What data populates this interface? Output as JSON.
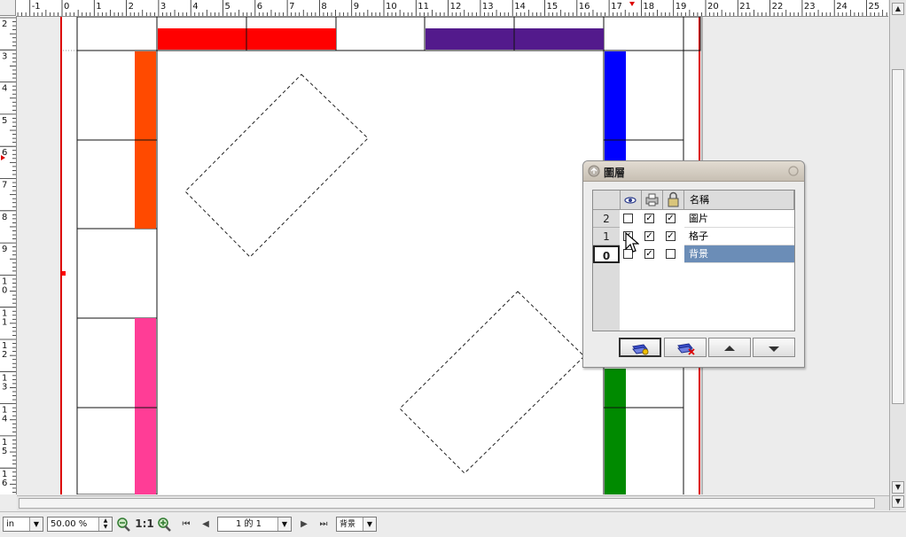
{
  "rulers": {
    "unit": "in",
    "horizontal_ticks": [
      "-1",
      "0",
      "1",
      "2",
      "3",
      "4",
      "5",
      "6",
      "7",
      "8",
      "9",
      "10",
      "11",
      "12",
      "13",
      "14",
      "15",
      "16",
      "17",
      "18",
      "19",
      "20",
      "21",
      "22",
      "23",
      "24",
      "25"
    ],
    "vertical_ticks": [
      "2",
      "3",
      "4",
      "5",
      "6",
      "7",
      "8",
      "9",
      "10",
      "11",
      "12",
      "13",
      "14",
      "15",
      "16"
    ]
  },
  "canvas": {
    "background": "#ececec",
    "page_color": "#ffffff",
    "margin_line_color": "#dd0000",
    "bars": {
      "top_red": "#ff0000",
      "top_purple": "#531a8c",
      "left_orange": "#ff4a00",
      "left_pink": "#ff3d96",
      "right_blue": "#0000ff",
      "right_green": "#008a00"
    }
  },
  "statusbar": {
    "unit": "in",
    "zoom": "50.00 %",
    "zoom_actual": "1:1",
    "page_indicator": "1 的 1",
    "layer_select": "背景"
  },
  "layers_panel": {
    "title": "圖層",
    "column_name": "名稱",
    "layers": [
      {
        "index": "2",
        "name": "圖片",
        "visible": false,
        "printable": true,
        "locked": true,
        "selected": false
      },
      {
        "index": "1",
        "name": "格子",
        "visible": true,
        "printable": true,
        "locked": true,
        "selected": false
      },
      {
        "index": "0",
        "name": "背景",
        "visible": false,
        "printable": true,
        "locked": false,
        "selected": true
      }
    ],
    "icons": [
      "eye-icon",
      "printer-icon",
      "lock-icon",
      "add-layer-icon",
      "delete-layer-icon",
      "arrow-up-icon",
      "arrow-down-icon"
    ],
    "selected_color": "#6b8db7"
  }
}
